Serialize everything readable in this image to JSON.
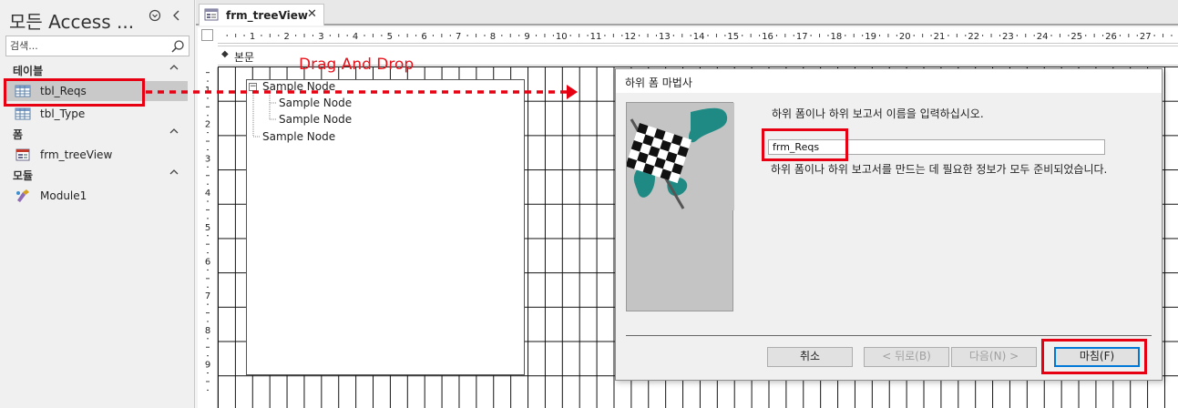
{
  "nav": {
    "title": "모든 Access ...",
    "search_placeholder": "검색...",
    "groups": [
      {
        "label": "테이블",
        "items": [
          {
            "label": "tbl_Reqs",
            "selected": true
          },
          {
            "label": "tbl_Type"
          }
        ]
      },
      {
        "label": "폼",
        "items": [
          {
            "label": "frm_treeView"
          }
        ]
      },
      {
        "label": "모듈",
        "items": [
          {
            "label": "Module1"
          }
        ]
      }
    ]
  },
  "tab": {
    "label": "frm_treeView"
  },
  "design": {
    "section_label": "본문",
    "ruler_h": [
      "1",
      "2",
      "3",
      "4",
      "5",
      "6",
      "7",
      "8",
      "9",
      "10",
      "11",
      "12",
      "13",
      "14",
      "15",
      "16",
      "17",
      "18",
      "19",
      "20",
      "21",
      "22",
      "23",
      "24",
      "25",
      "26",
      "27"
    ],
    "ruler_v": [
      "1",
      "2",
      "3",
      "4",
      "5",
      "6",
      "7",
      "8",
      "9"
    ],
    "tree_nodes": [
      "Sample Node",
      "Sample Node",
      "Sample Node",
      "Sample Node"
    ]
  },
  "annotation": {
    "drag_label": "Drag And Drop",
    "color": "#e60012"
  },
  "wizard": {
    "title": "하위 폼 마법사",
    "prompt": "하위 폼이나 하위 보고서 이름을 입력하십시오.",
    "name_value": "frm_Reqs",
    "info": "하위 폼이나 하위 보고서를 만드는 데 필요한 정보가 모두 준비되었습니다.",
    "buttons": {
      "cancel": "취소",
      "back": "< 뒤로(B)",
      "next": "다음(N) >",
      "finish": "마침(F)"
    }
  }
}
